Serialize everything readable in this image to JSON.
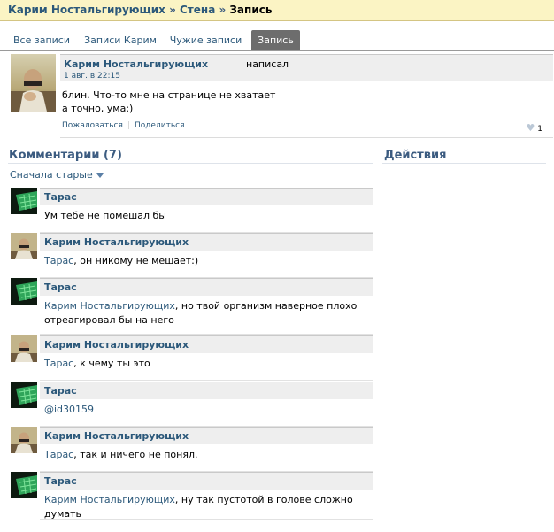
{
  "breadcrumb": {
    "part1": "Карим Ностальгирующих",
    "sep1": " » ",
    "part2": "Стена",
    "sep2": " » ",
    "current": "Запись"
  },
  "tabs": [
    {
      "label": "Все записи"
    },
    {
      "label": "Записи Карим"
    },
    {
      "label": "Чужие записи"
    },
    {
      "label": "Запись"
    }
  ],
  "post": {
    "author": "Карим Ностальгирующих",
    "verb": "написал",
    "date": "1 авг. в 22:15",
    "text_line1": "блин. Что-то мне на странице не хватает",
    "text_line2": "а точно, ума:)",
    "report": "Пожаловаться",
    "share": "Поделиться",
    "likes": "1"
  },
  "comments_section": {
    "title": "Комментарии (7)",
    "sort_label": "Сначала старые"
  },
  "actions_section": {
    "title": "Действия"
  },
  "comments": [
    {
      "author": "Тарас",
      "avatar": "taras",
      "mention": "",
      "text": "Ум тебе не помешал бы",
      "text2": ""
    },
    {
      "author": "Карим Ностальгирующих",
      "avatar": "karim",
      "mention": "Тарас",
      "text": ", он никому не мешает:)",
      "text2": ""
    },
    {
      "author": "Тарас",
      "avatar": "taras",
      "mention": "Карим Ностальгирующих",
      "text": ", но твой организм наверное плохо",
      "text2": "отреагировал бы на него"
    },
    {
      "author": "Карим Ностальгирующих",
      "avatar": "karim",
      "mention": "Тарас",
      "text": ", к чему ты это",
      "text2": ""
    },
    {
      "author": "Тарас",
      "avatar": "taras",
      "mention": "@id30159",
      "text": "",
      "text2": ""
    },
    {
      "author": "Карим Ностальгирующих",
      "avatar": "karim",
      "mention": "Тарас",
      "text": ", так и ничего не понял.",
      "text2": ""
    },
    {
      "author": "Тарас",
      "avatar": "taras",
      "mention": "Карим Ностальгирующих",
      "text": ", ну так пустотой в голове сложно думать",
      "text2": ""
    }
  ],
  "colors": {
    "link": "#2b587a",
    "breadcrumb_bg": "#fbf4c4",
    "tab_active_bg": "#6d6d6d",
    "head_bg": "#eeeeee"
  }
}
